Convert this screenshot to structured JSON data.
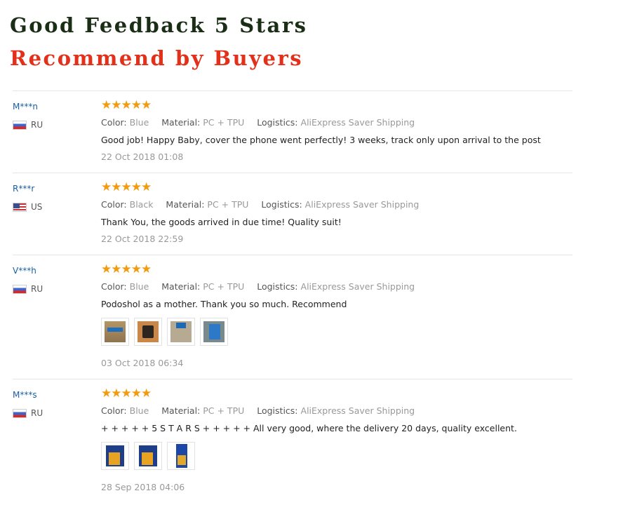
{
  "header": {
    "line1": "Good Feedback 5 Stars",
    "line2": "Recommend by Buyers"
  },
  "reviews": [
    {
      "buyer": "M***n",
      "country": "RU",
      "rating": 5,
      "stars": "★★★★★",
      "color_label": "Color:",
      "color": "Blue",
      "material_label": "Material:",
      "material": "PC + TPU",
      "logistics_label": "Logistics:",
      "logistics": "AliExpress Saver Shipping",
      "text": "Good job! Happy Baby, cover the phone went perfectly! 3 weeks, track only upon arrival to the post",
      "date": "22 Oct 2018 01:08"
    },
    {
      "buyer": "R***r",
      "country": "US",
      "rating": 5,
      "stars": "★★★★★",
      "color_label": "Color:",
      "color": "Black",
      "material_label": "Material:",
      "material": "PC + TPU",
      "logistics_label": "Logistics:",
      "logistics": "AliExpress Saver Shipping",
      "text": "Thank You, the goods arrived in due time! Quality suit!",
      "date": "22 Oct 2018 22:59"
    },
    {
      "buyer": "V***h",
      "country": "RU",
      "rating": 5,
      "stars": "★★★★★",
      "color_label": "Color:",
      "color": "Blue",
      "material_label": "Material:",
      "material": "PC + TPU",
      "logistics_label": "Logistics:",
      "logistics": "AliExpress Saver Shipping",
      "text": "Podoshol as a mother. Thank you so much. Recommend",
      "date": "03 Oct 2018 06:34"
    },
    {
      "buyer": "M***s",
      "country": "RU",
      "rating": 5,
      "stars": "★★★★★",
      "color_label": "Color:",
      "color": "Blue",
      "material_label": "Material:",
      "material": "PC + TPU",
      "logistics_label": "Logistics:",
      "logistics": "AliExpress Saver Shipping",
      "text": "+ + + + + 5 S T A R S + + + + + All very good, where the delivery 20 days, quality excellent.",
      "date": "28 Sep 2018 04:06"
    }
  ],
  "colors": {
    "heading_dark": "#1a2e16",
    "heading_red": "#e2301a",
    "star": "#f39b0f",
    "buyer_link": "#1a5fa6"
  }
}
